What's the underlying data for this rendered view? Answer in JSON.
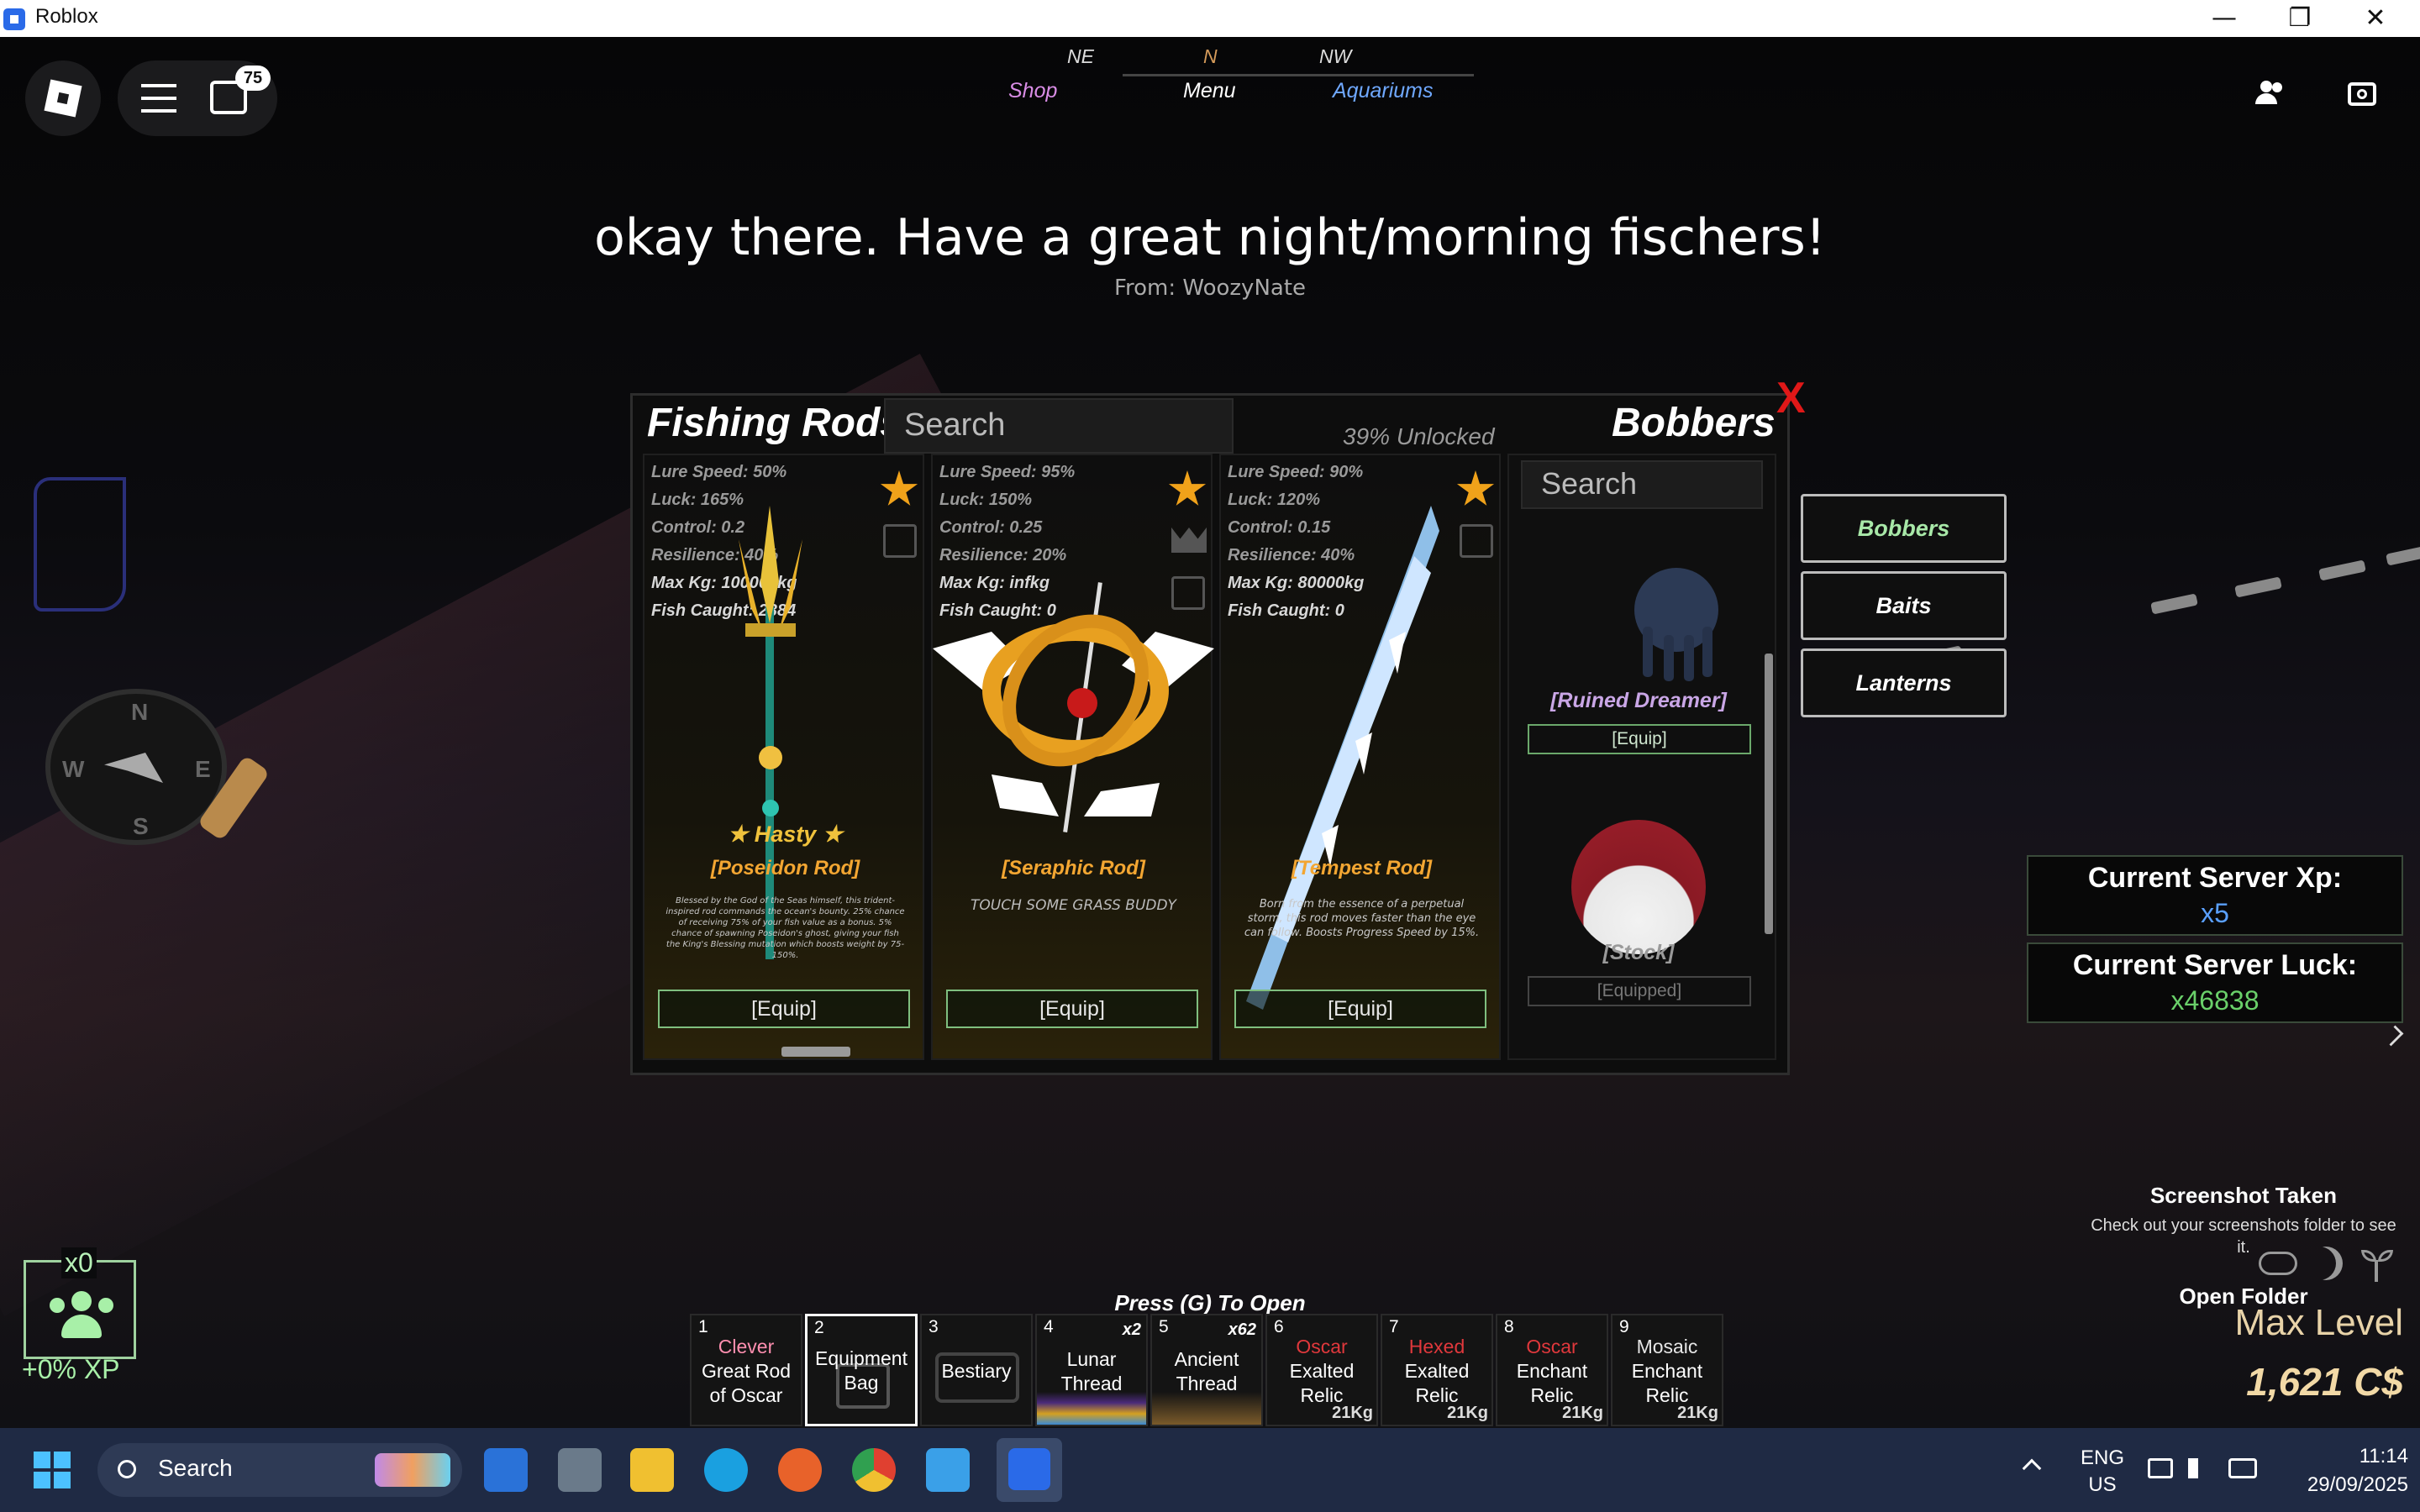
{
  "window": {
    "title": "Roblox",
    "minimize": "—",
    "restore": "❐",
    "close": "✕"
  },
  "hud": {
    "chat_badge": "75",
    "compass": {
      "ne": "NE",
      "n": "N",
      "nw": "NW"
    },
    "nav": {
      "shop": "Shop",
      "menu": "Menu",
      "aquariums": "Aquariums"
    }
  },
  "announcement": {
    "message": "okay there. Have a great night/morning fischers!",
    "from": "From: WoozyNate"
  },
  "minimap_compass": {
    "n": "N",
    "s": "S",
    "e": "E",
    "w": "W"
  },
  "panel": {
    "title": "Fishing Rods",
    "search_placeholder": "Search",
    "unlocked": "39% Unlocked",
    "right_title": "Bobbers",
    "close": "X",
    "rods": [
      {
        "stats": [
          "Lure Speed: 50%",
          "Luck: 165%",
          "Control: 0.2",
          "Resilience: 40%",
          "Max Kg: 100000kg",
          "Fish Caught: 2384"
        ],
        "enchant": "★ Hasty ★",
        "name": "[Poseidon Rod]",
        "desc": "Blessed by the God of the Seas himself, this trident-inspired rod commands the ocean's bounty. 25% chance of receiving 75% of your fish value as a bonus. 5% chance of spawning Poseidon's ghost, giving your fish the King's Blessing mutation which boosts weight by 75-150%.",
        "equip": "[Equip]"
      },
      {
        "stats": [
          "Lure Speed: 95%",
          "Luck: 150%",
          "Control: 0.25",
          "Resilience: 20%",
          "Max Kg: infkg",
          "Fish Caught: 0"
        ],
        "name": "[Seraphic Rod]",
        "desc": "TOUCH SOME GRASS BUDDY",
        "equip": "[Equip]"
      },
      {
        "stats": [
          "Lure Speed: 90%",
          "Luck: 120%",
          "Control: 0.15",
          "Resilience: 40%",
          "Max Kg: 80000kg",
          "Fish Caught: 0"
        ],
        "name": "[Tempest Rod]",
        "desc": "Born from the essence of a perpetual storm, this rod moves faster than the eye can follow. Boosts Progress Speed by 15%.",
        "equip": "[Equip]"
      }
    ],
    "bobbers": {
      "search_placeholder": "Search",
      "items": [
        {
          "name": "[Ruined Dreamer]",
          "action": "[Equip]",
          "color": "#c9a6e6"
        },
        {
          "name": "[Stock]",
          "action": "[Equipped]",
          "color": "#9a9a9a"
        }
      ]
    },
    "tabs": [
      "Bobbers",
      "Baits",
      "Lanterns"
    ]
  },
  "server": {
    "xp_label": "Current Server Xp:",
    "xp_value": "x5",
    "luck_label": "Current Server Luck:",
    "luck_value": "x46838"
  },
  "party": {
    "count": "x0",
    "xp": "+0% XP"
  },
  "notification": {
    "title": "Screenshot Taken",
    "body": "Check out your screenshots folder to see it.",
    "action": "Open Folder"
  },
  "level": {
    "label": "Max Level",
    "currency": "1,621 C$"
  },
  "hotbar": {
    "hint": "Press (G) To Open",
    "slots": [
      {
        "num": "1",
        "prefix": "Clever",
        "prefix_color": "#ff8fb0",
        "label": "Great Rod of Oscar"
      },
      {
        "num": "2",
        "label": "Equipment Bag"
      },
      {
        "num": "3",
        "label": "Bestiary"
      },
      {
        "num": "4",
        "label": "Lunar Thread",
        "mult": "x2"
      },
      {
        "num": "5",
        "label": "Ancient Thread",
        "mult": "x62"
      },
      {
        "num": "6",
        "prefix": "Oscar",
        "prefix_color": "#e0383c",
        "label": "Exalted Relic",
        "kg": "21Kg"
      },
      {
        "num": "7",
        "prefix": "Hexed",
        "prefix_color": "#e0383c",
        "label": "Exalted Relic",
        "kg": "21Kg"
      },
      {
        "num": "8",
        "prefix": "Oscar",
        "prefix_color": "#e0383c",
        "label": "Enchant Relic",
        "kg": "21Kg"
      },
      {
        "num": "9",
        "prefix": "Mosaic",
        "prefix_color": "#e6e6e6",
        "label": "Enchant Relic",
        "kg": "21Kg"
      }
    ]
  },
  "taskbar": {
    "search": "Search",
    "lang_top": "ENG",
    "lang_bottom": "US",
    "time": "11:14",
    "date": "29/09/2025"
  }
}
